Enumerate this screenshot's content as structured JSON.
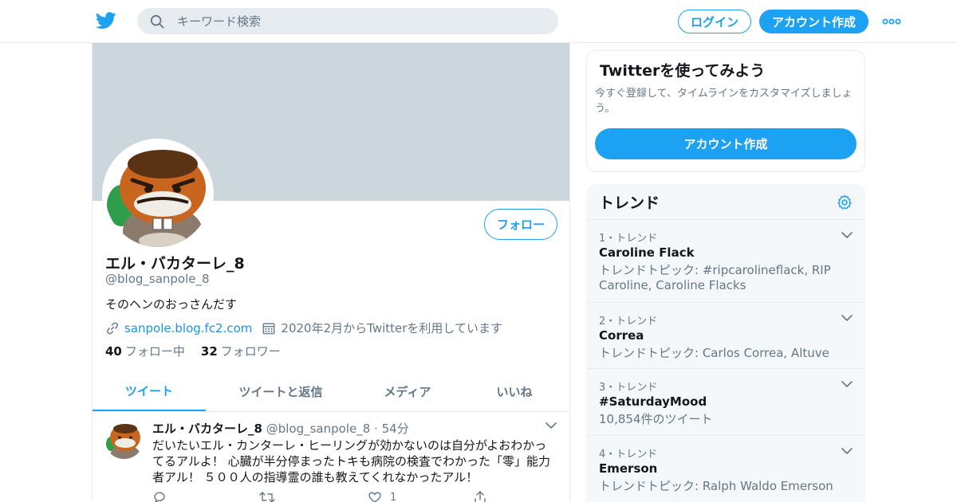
{
  "header": {
    "search_placeholder": "キーワード検索",
    "login_label": "ログイン",
    "signup_label": "アカウント作成"
  },
  "profile": {
    "name": "エル・バカターレ_8",
    "handle": "@blog_sanpole_8",
    "bio": "そのヘンのおっさんだす",
    "website": "sanpole.blog.fc2.com",
    "joined": "2020年2月からTwitterを利用しています",
    "following_count": "40",
    "following_label": "フォロー中",
    "followers_count": "32",
    "followers_label": "フォロワー",
    "follow_button": "フォロー"
  },
  "tabs": [
    {
      "label": "ツイート",
      "active": true
    },
    {
      "label": "ツイートと返信",
      "active": false
    },
    {
      "label": "メディア",
      "active": false
    },
    {
      "label": "いいね",
      "active": false
    }
  ],
  "tweet": {
    "name": "エル・バカターレ_8",
    "handle": "@blog_sanpole_8",
    "separator": "·",
    "time": "54分",
    "text": "だいたいエル・カンターレ・ヒーリングが効かないのは自分がよおわかってるアルよ！ 心臓が半分停まったトキも病院の検査でわかった「零」能力者アル！ ５００人の指導霊の誰も教えてくれなかったアル！",
    "like_count": "1"
  },
  "signup_card": {
    "title": "Twitterを使ってみよう",
    "description": "今すぐ登録して、タイムラインをカスタマイズしましょう。",
    "button": "アカウント作成"
  },
  "trends": {
    "title": "トレンド",
    "items": [
      {
        "rank": "1・トレンド",
        "name": "Caroline Flack",
        "desc": "トレンドトピック: #ripcarolineflack, RIP Caroline, Caroline Flacks"
      },
      {
        "rank": "2・トレンド",
        "name": "Correa",
        "desc": "トレンドトピック: Carlos Correa, Altuve"
      },
      {
        "rank": "3・トレンド",
        "name": "#SaturdayMood",
        "desc": "10,854件のツイート"
      },
      {
        "rank": "4・トレンド",
        "name": "Emerson",
        "desc": "トレンドトピック: Ralph Waldo Emerson"
      }
    ]
  },
  "colors": {
    "accent": "#1da1f2",
    "banner": "#ccd6dd",
    "muted_text": "#657786",
    "border": "#e6ecf0"
  }
}
